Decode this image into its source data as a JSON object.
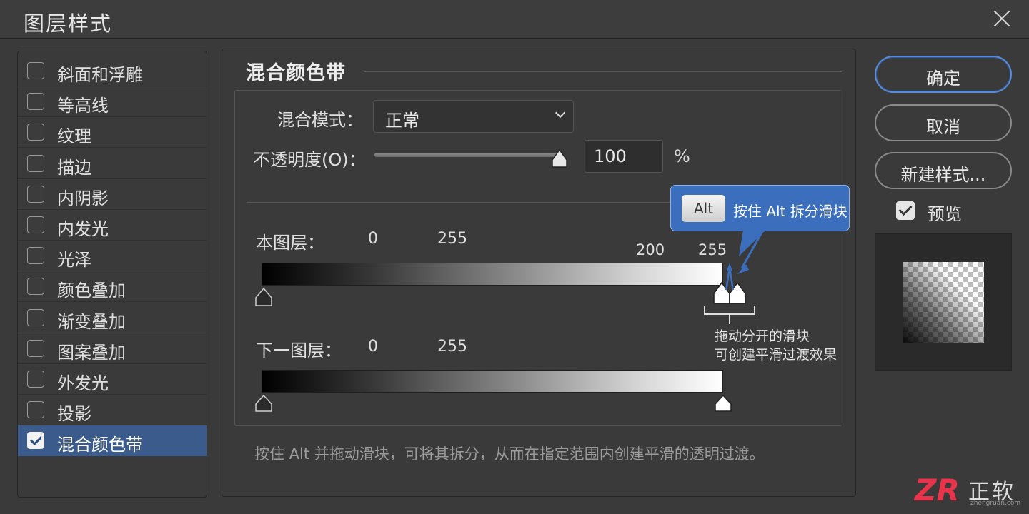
{
  "window": {
    "title": "图层样式"
  },
  "sidebar": {
    "items": [
      {
        "label": "斜面和浮雕",
        "checked": false
      },
      {
        "label": "等高线",
        "checked": false
      },
      {
        "label": "纹理",
        "checked": false
      },
      {
        "label": "描边",
        "checked": false
      },
      {
        "label": "内阴影",
        "checked": false
      },
      {
        "label": "内发光",
        "checked": false
      },
      {
        "label": "光泽",
        "checked": false
      },
      {
        "label": "颜色叠加",
        "checked": false
      },
      {
        "label": "渐变叠加",
        "checked": false
      },
      {
        "label": "图案叠加",
        "checked": false
      },
      {
        "label": "外发光",
        "checked": false
      },
      {
        "label": "投影",
        "checked": false
      },
      {
        "label": "混合颜色带",
        "checked": true
      }
    ]
  },
  "panel": {
    "title": "混合颜色带",
    "blend_mode_label": "混合模式：",
    "blend_mode_value": "正常",
    "opacity_label": "不透明度(O)：",
    "opacity_value": "100",
    "opacity_unit": "%",
    "this_layer": {
      "label": "本图层：",
      "min": "0",
      "max": "255",
      "split_low": "200",
      "split_high": "255"
    },
    "underlying_layer": {
      "label": "下一图层：",
      "min": "0",
      "max": "255"
    },
    "tooltip": {
      "key": "Alt",
      "text": "按住 Alt 拆分滑块"
    },
    "annotation": {
      "line1": "拖动分开的滑块",
      "line2": "可创建平滑过渡效果"
    },
    "help_text": "按住 Alt 并拖动滑块，可将其拆分，从而在指定范围内创建平滑的透明过渡。"
  },
  "buttons": {
    "ok": "确定",
    "cancel": "取消",
    "new_style": "新建样式...",
    "preview_label": "预览",
    "preview_checked": true
  },
  "watermark": {
    "text": "正软",
    "mark": "ZR",
    "url": "zhengruan.com"
  },
  "colors": {
    "accent": "#3b6fbd",
    "active_item": "#3a5b8c",
    "logo": "#e8334a"
  }
}
